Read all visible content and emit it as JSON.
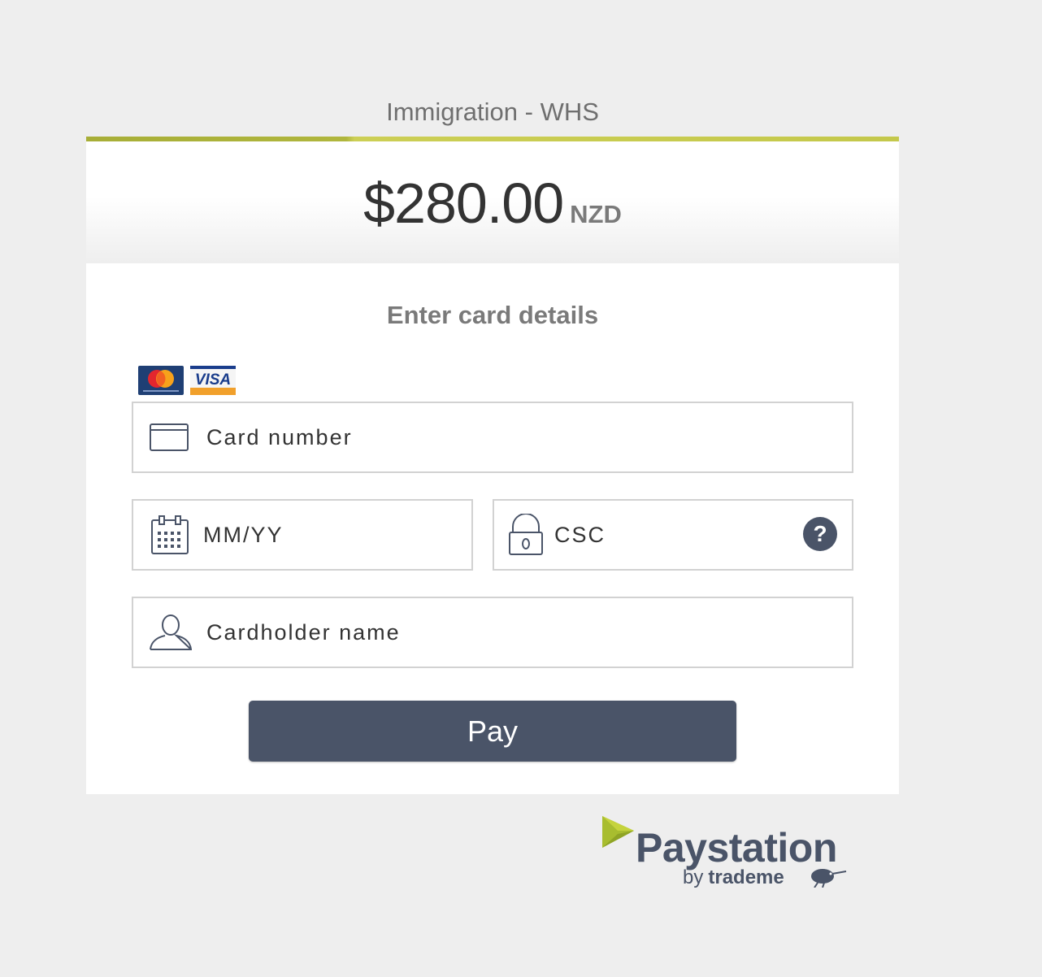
{
  "merchant": {
    "name": "Immigration - WHS"
  },
  "payment": {
    "amount": "$280.00",
    "currency": "NZD"
  },
  "form": {
    "title": "Enter card details",
    "accepted_cards": [
      "mastercard-logo",
      "visa-logo"
    ],
    "visa_text": "VISA",
    "card_number_placeholder": "Card number",
    "expiry_placeholder": "MM/YY",
    "csc_placeholder": "CSC",
    "csc_help_symbol": "?",
    "cardholder_placeholder": "Cardholder name",
    "pay_label": "Pay"
  },
  "footer": {
    "brand": "Paystation",
    "by": "by",
    "company": "trademe"
  },
  "colors": {
    "accent": "#c4c84b",
    "button": "#4a5468",
    "background": "#eeeeee"
  }
}
